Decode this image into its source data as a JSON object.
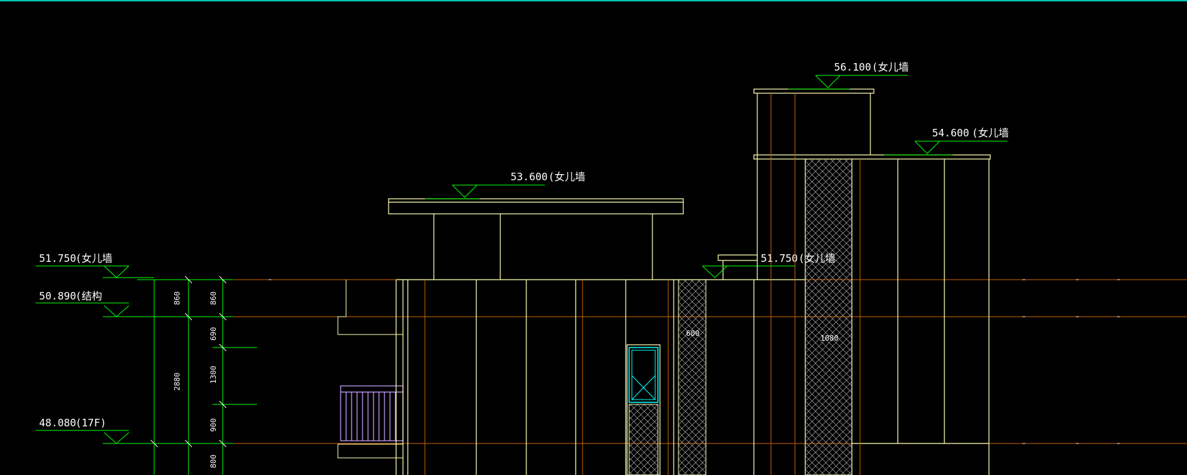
{
  "drawing": {
    "colors": {
      "background": "#000000",
      "top_border": "#00c8b4",
      "building_outline": "#ffffb4",
      "grid_lines": "#c86400",
      "level_markers": "#00ff00",
      "text": "#ffffff",
      "window_frame": "#00ffff",
      "railing": "#c8a0ff"
    },
    "left_levels": [
      {
        "elevation": "51.750",
        "note": "(女儿墙"
      },
      {
        "elevation": "50.890",
        "note": "(结构"
      },
      {
        "elevation": "48.080",
        "note": "(17F)"
      }
    ],
    "top_levels": [
      {
        "elevation": "56.100",
        "note": "(女儿墙"
      },
      {
        "elevation": "54.600",
        "note": "(女儿墙"
      },
      {
        "elevation": "53.600",
        "note": "(女儿墙"
      },
      {
        "elevation": "51.750",
        "note": "(女儿墙"
      }
    ],
    "dimensions": {
      "outer": [
        "860",
        "2880"
      ],
      "inner": [
        "860",
        "690",
        "1300",
        "900",
        "800"
      ],
      "hatch_a": "600",
      "hatch_b": "1080"
    }
  }
}
